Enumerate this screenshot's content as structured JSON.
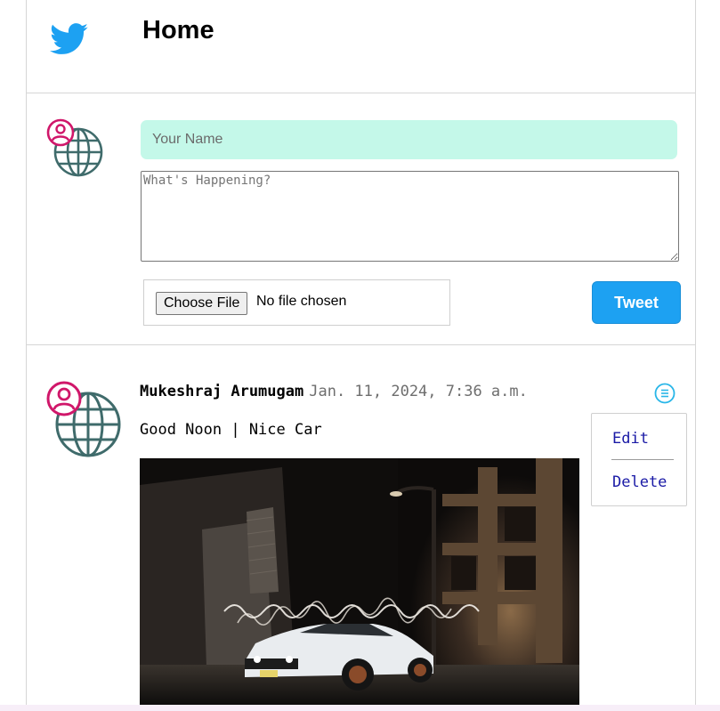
{
  "header": {
    "logo_icon": "twitter-bird-icon",
    "title": "Home"
  },
  "composer": {
    "avatar_icon": "globe-user-icon",
    "name_placeholder": "Your Name",
    "name_value": "",
    "text_placeholder": "What's Happening?",
    "text_value": "",
    "choose_file_label": "Choose File",
    "file_status": "No file chosen",
    "tweet_label": "Tweet"
  },
  "post": {
    "avatar_icon": "globe-user-icon",
    "author": "Mukeshraj Arumugam",
    "timestamp": "Jan. 11, 2024, 7:36 a.m.",
    "text": "Good Noon | Nice Car",
    "menu_icon": "list-menu-icon",
    "menu": {
      "edit_label": "Edit",
      "delete_label": "Delete"
    },
    "image": "white-muscle-car-night-photo"
  },
  "colors": {
    "brand": "#1da1f2",
    "name_field_bg": "#c4f8e9",
    "avatar_pink": "#d0176a",
    "globe_teal": "#3f6b6b",
    "link": "#1a1aa6"
  }
}
